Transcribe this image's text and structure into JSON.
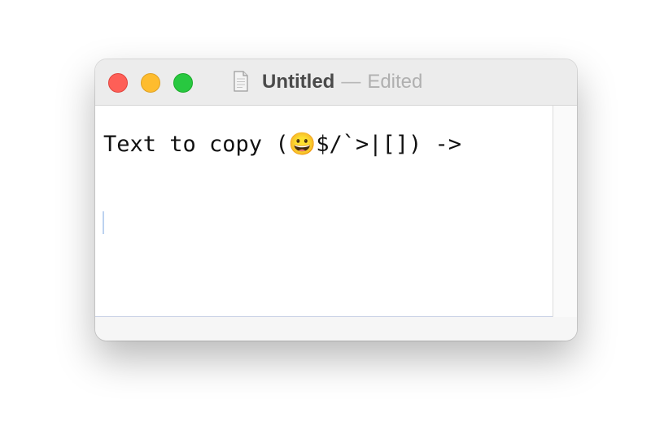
{
  "window": {
    "title": "Untitled",
    "separator": "—",
    "status": "Edited"
  },
  "traffic_lights": {
    "close_color": "#fe5f57",
    "minimize_color": "#febc2e",
    "zoom_color": "#28c840"
  },
  "icons": {
    "document": "document-icon"
  },
  "editor": {
    "text": "Text to copy (😀$/`>|[]) ->"
  }
}
